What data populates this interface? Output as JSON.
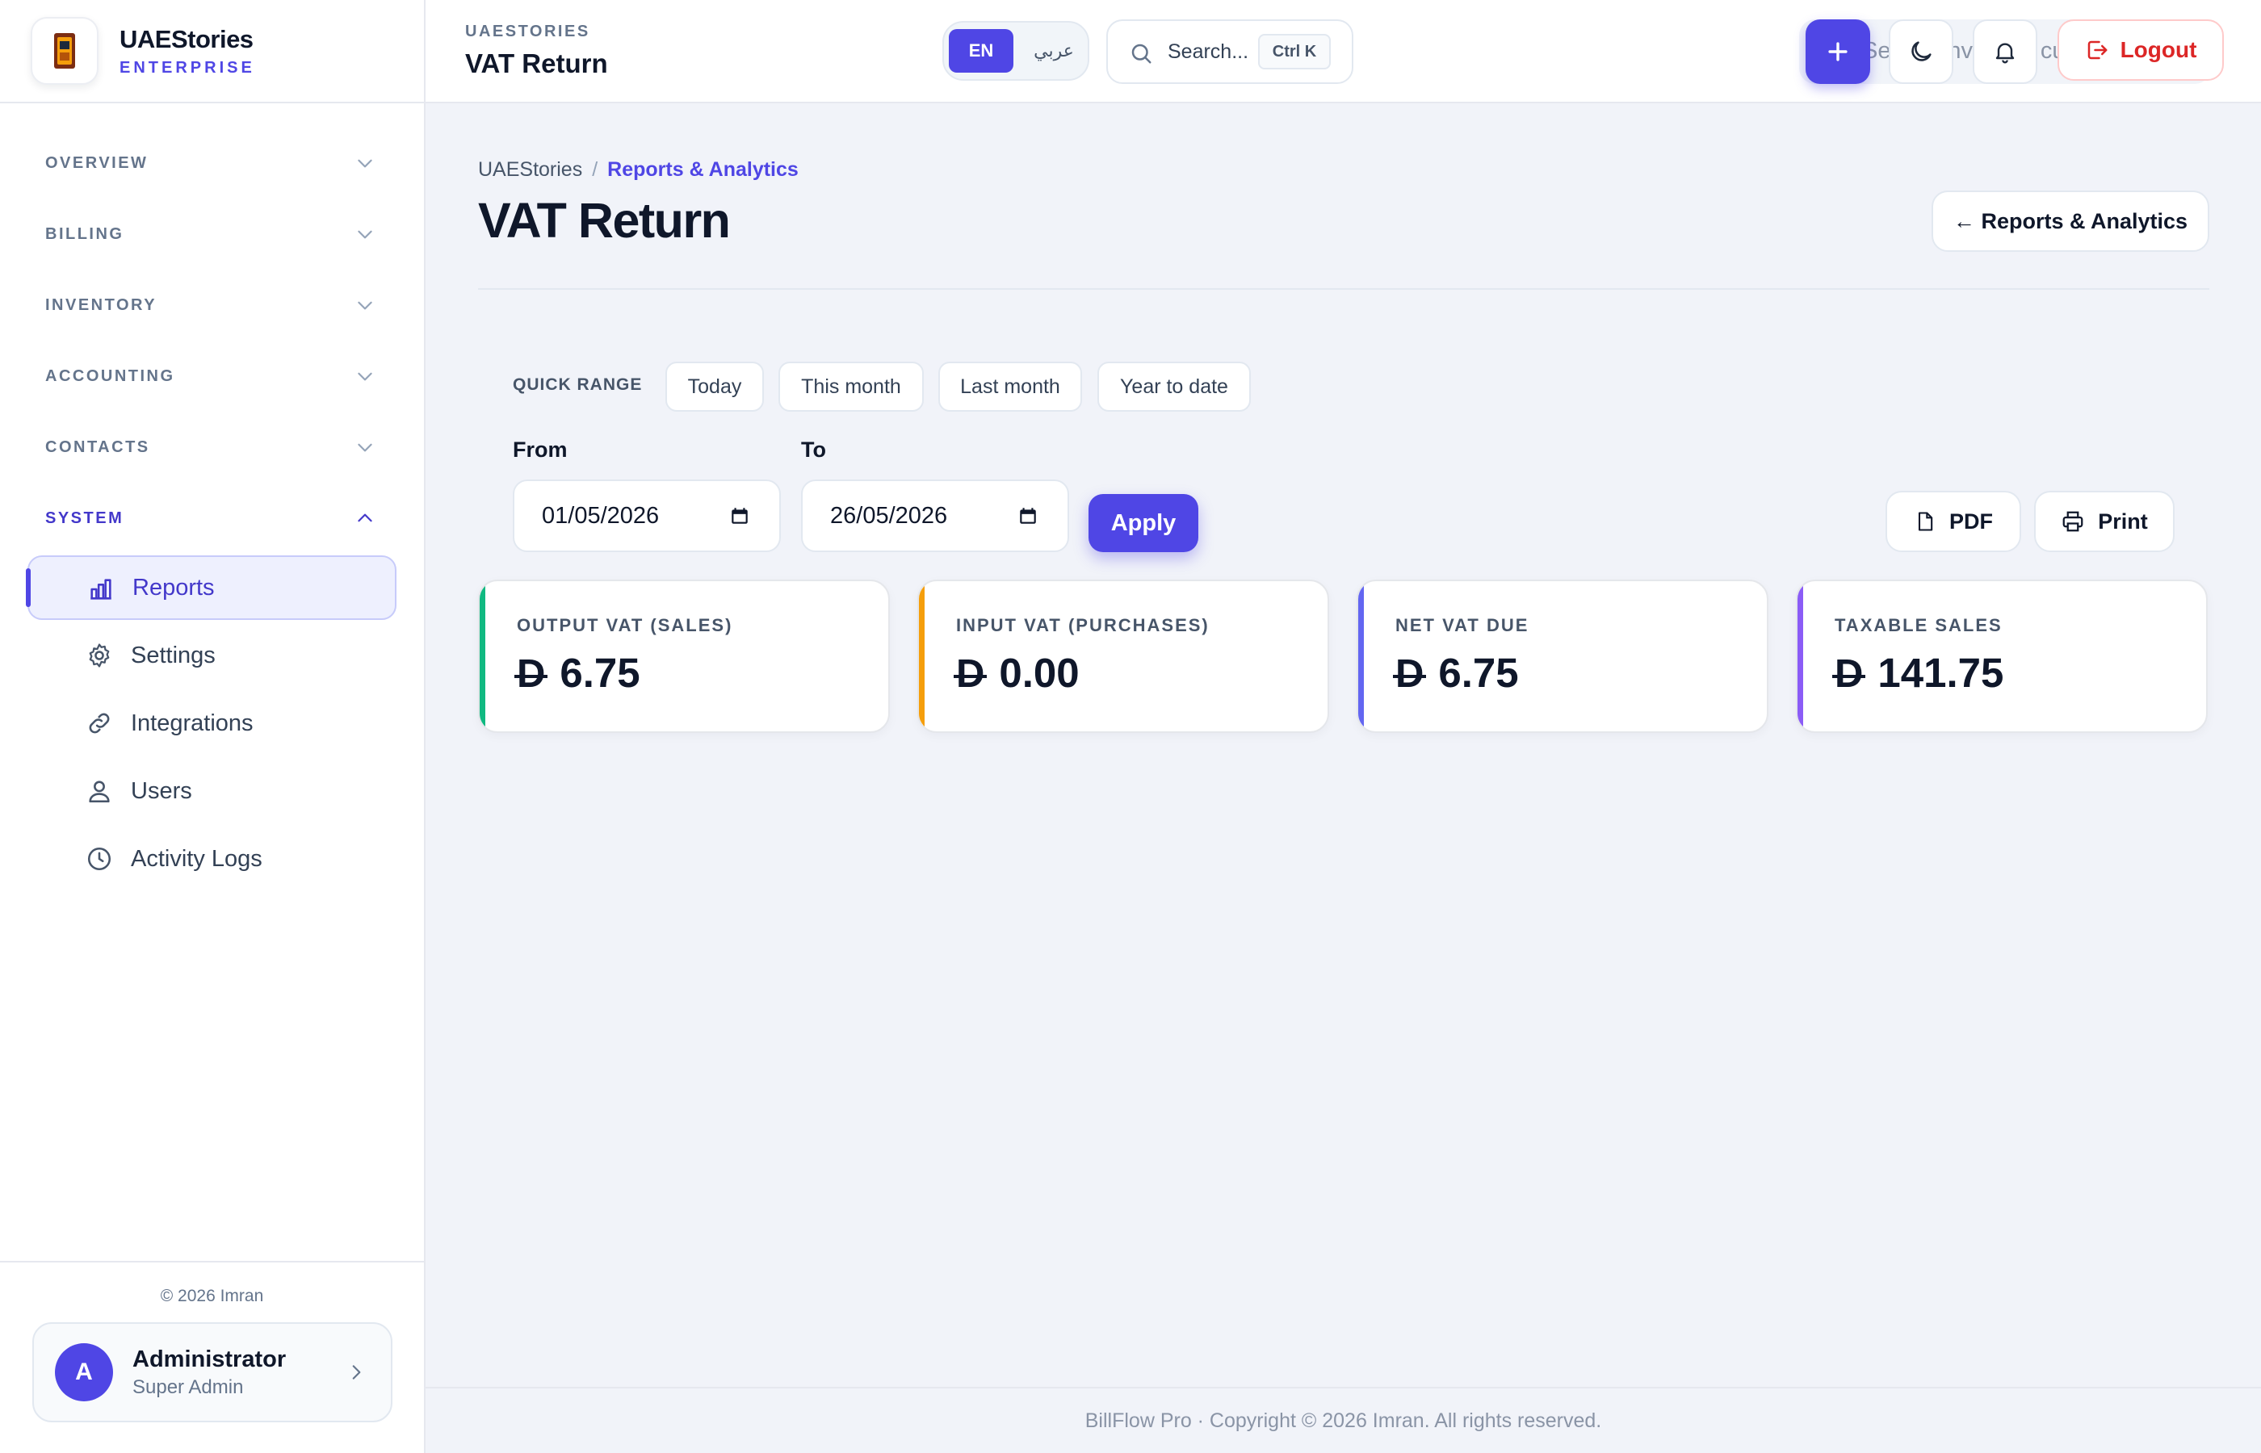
{
  "brand": {
    "name": "UAEStories",
    "subtitle": "ENTERPRISE"
  },
  "sidebar": {
    "sections": [
      {
        "label": "OVERVIEW",
        "expanded": false
      },
      {
        "label": "BILLING",
        "expanded": false
      },
      {
        "label": "INVENTORY",
        "expanded": false
      },
      {
        "label": "ACCOUNTING",
        "expanded": false
      },
      {
        "label": "CONTACTS",
        "expanded": false
      },
      {
        "label": "SYSTEM",
        "expanded": true
      }
    ],
    "items": [
      {
        "label": "Reports",
        "icon": "bar-chart-icon",
        "active": true
      },
      {
        "label": "Settings",
        "icon": "gear-icon",
        "active": false
      },
      {
        "label": "Integrations",
        "icon": "link-icon",
        "active": false
      },
      {
        "label": "Users",
        "icon": "users-icon",
        "active": false
      },
      {
        "label": "Activity Logs",
        "icon": "clock-icon",
        "active": false
      }
    ],
    "copyright": "© 2026 Imran",
    "user": {
      "initial": "A",
      "name": "Administrator",
      "role": "Super Admin"
    }
  },
  "topbar": {
    "kicker": "UAESTORIES",
    "title": "VAT Return",
    "lang_en": "EN",
    "lang_ar": "عربي",
    "command_search": "Search...",
    "command_shortcut": "Ctrl K",
    "search_placeholder": "Search invoices, customers",
    "logout_label": "Logout"
  },
  "main": {
    "breadcrumb": {
      "root": "UAEStories",
      "separator": "/",
      "current": "Reports & Analytics"
    },
    "title": "VAT Return",
    "back_label": "← Reports & Analytics",
    "quick_range_label": "QUICK RANGE",
    "quick_ranges": [
      "Today",
      "This month",
      "Last month",
      "Year to date"
    ],
    "from_label": "From",
    "from_value": "01/05/2026",
    "to_label": "To",
    "to_value": "26/05/2026",
    "apply_label": "Apply",
    "pdf_label": "PDF",
    "print_label": "Print",
    "currency_symbol": "D",
    "cards": [
      {
        "label": "OUTPUT VAT (SALES)",
        "value": "6.75",
        "accent": "#10b981"
      },
      {
        "label": "INPUT VAT (PURCHASES)",
        "value": "0.00",
        "accent": "#f59e0b"
      },
      {
        "label": "NET VAT DUE",
        "value": "6.75",
        "accent": "#6366f1"
      },
      {
        "label": "TAXABLE SALES",
        "value": "141.75",
        "accent": "#8b5cf6"
      }
    ]
  },
  "footer": {
    "text": "BillFlow Pro · Copyright © 2026 Imran. All rights reserved."
  },
  "colors": {
    "primary": "#4f46e5",
    "danger": "#dc2626"
  }
}
